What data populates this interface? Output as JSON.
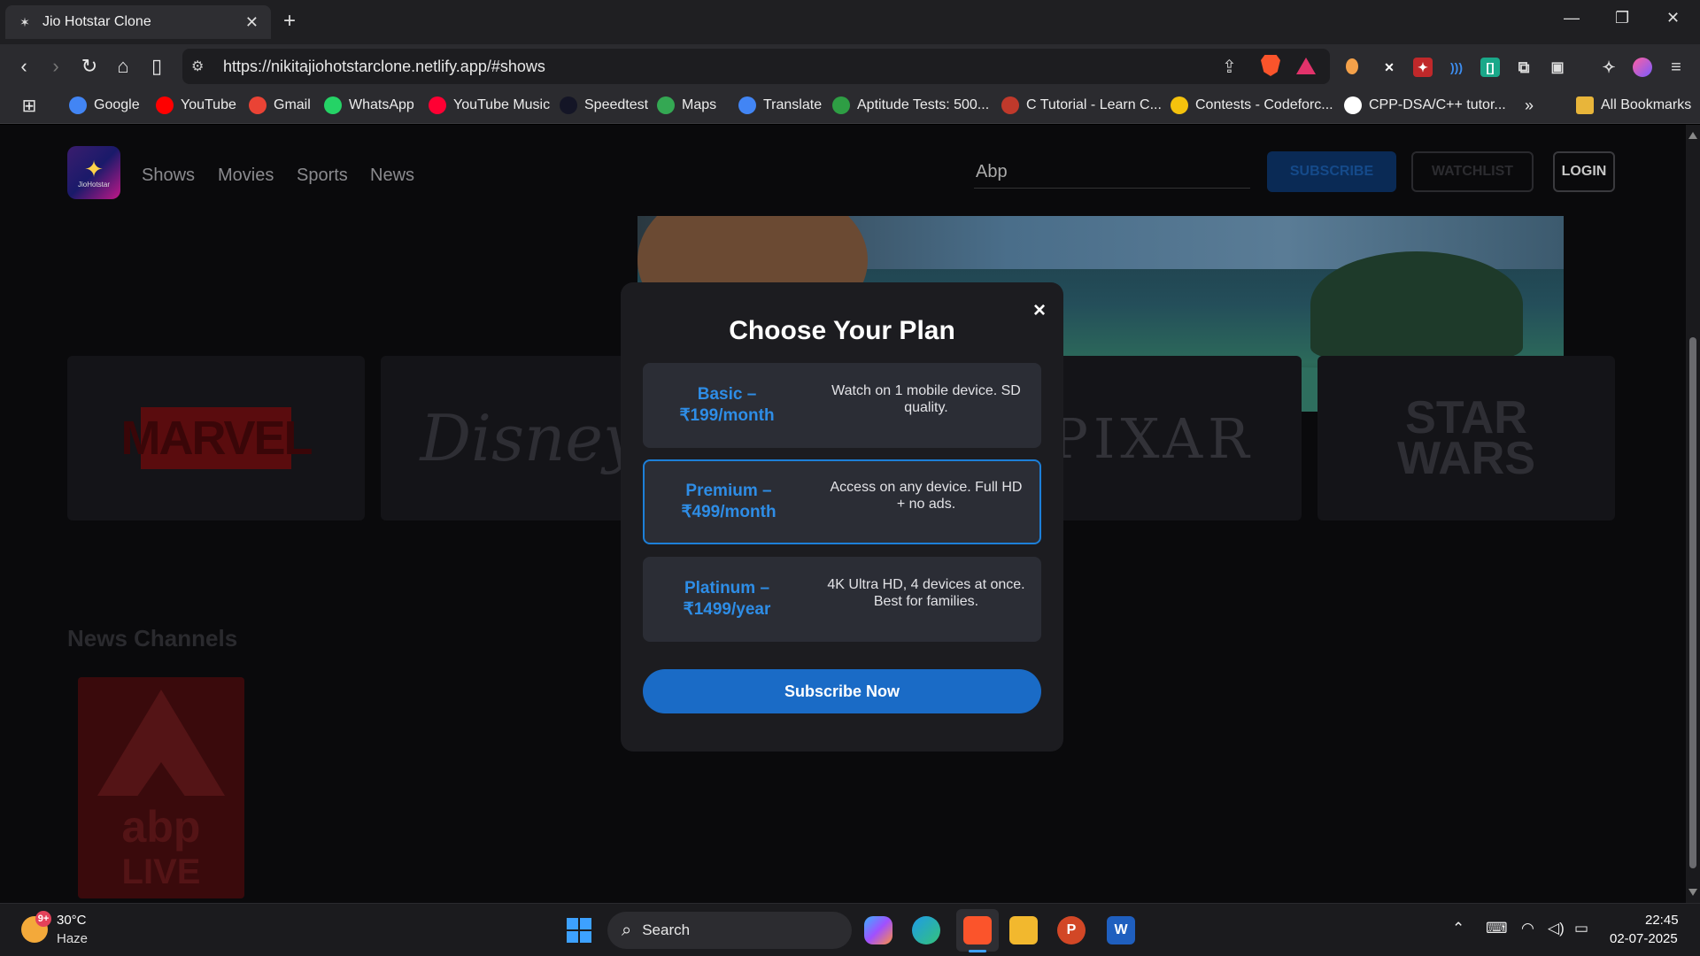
{
  "browser": {
    "tab_title": "Jio Hotstar Clone",
    "url": "https://nikitajiohotstarclone.netlify.app/#shows",
    "bookmarks": [
      {
        "label": "Google",
        "icon": "google-icon",
        "color": "#4285f4"
      },
      {
        "label": "YouTube",
        "icon": "youtube-icon",
        "color": "#ff0000"
      },
      {
        "label": "Gmail",
        "icon": "gmail-icon",
        "color": "#ea4335"
      },
      {
        "label": "WhatsApp",
        "icon": "whatsapp-icon",
        "color": "#25d366"
      },
      {
        "label": "YouTube Music",
        "icon": "youtube-music-icon",
        "color": "#ff0033"
      },
      {
        "label": "Speedtest",
        "icon": "speedtest-icon",
        "color": "#141526"
      },
      {
        "label": "Maps",
        "icon": "maps-icon",
        "color": "#34a853"
      },
      {
        "label": "Translate",
        "icon": "translate-icon",
        "color": "#4285f4"
      },
      {
        "label": "Aptitude Tests: 500...",
        "icon": "check-icon",
        "color": "#2e9e44"
      },
      {
        "label": "C Tutorial - Learn C...",
        "icon": "c-tutorial-icon",
        "color": "#c0392b"
      },
      {
        "label": "Contests - Codeforc...",
        "icon": "codeforces-icon",
        "color": "#f4c20d"
      },
      {
        "label": "CPP-DSA/C++ tutor...",
        "icon": "github-icon",
        "color": "#ffffff"
      }
    ],
    "all_bookmarks": "All Bookmarks"
  },
  "site": {
    "logo_text": "JioHotstar",
    "nav": [
      "Shows",
      "Movies",
      "Sports",
      "News"
    ],
    "search_value": "Abp",
    "subscribe_label": "SUBSCRIBE",
    "watchlist_label": "WATCHLIST",
    "login_label": "LOGIN",
    "brands": [
      "MARVEL",
      "Disney",
      "PIXAR",
      "STAR WARS"
    ],
    "news_heading": "News Channels",
    "news_channel": {
      "top": "abp",
      "bottom": "LIVE"
    }
  },
  "modal": {
    "title": "Choose Your Plan",
    "close": "×",
    "plans": [
      {
        "name": "Basic – ₹199/month",
        "desc": "Watch on 1 mobile device. SD quality.",
        "selected": false
      },
      {
        "name": "Premium – ₹499/month",
        "desc": "Access on any device. Full HD + no ads.",
        "selected": true
      },
      {
        "name": "Platinum – ₹1499/year",
        "desc": "4K Ultra HD, 4 devices at once. Best for families.",
        "selected": false
      }
    ],
    "cta": "Subscribe Now"
  },
  "taskbar": {
    "weather_temp": "30°C",
    "weather_desc": "Haze",
    "weather_badge": "9+",
    "search_label": "Search",
    "time": "22:45",
    "date": "02-07-2025"
  },
  "colors": {
    "accent": "#1a6bc6",
    "plan_name": "#2e8de6",
    "modal_bg": "#1c1c20"
  }
}
